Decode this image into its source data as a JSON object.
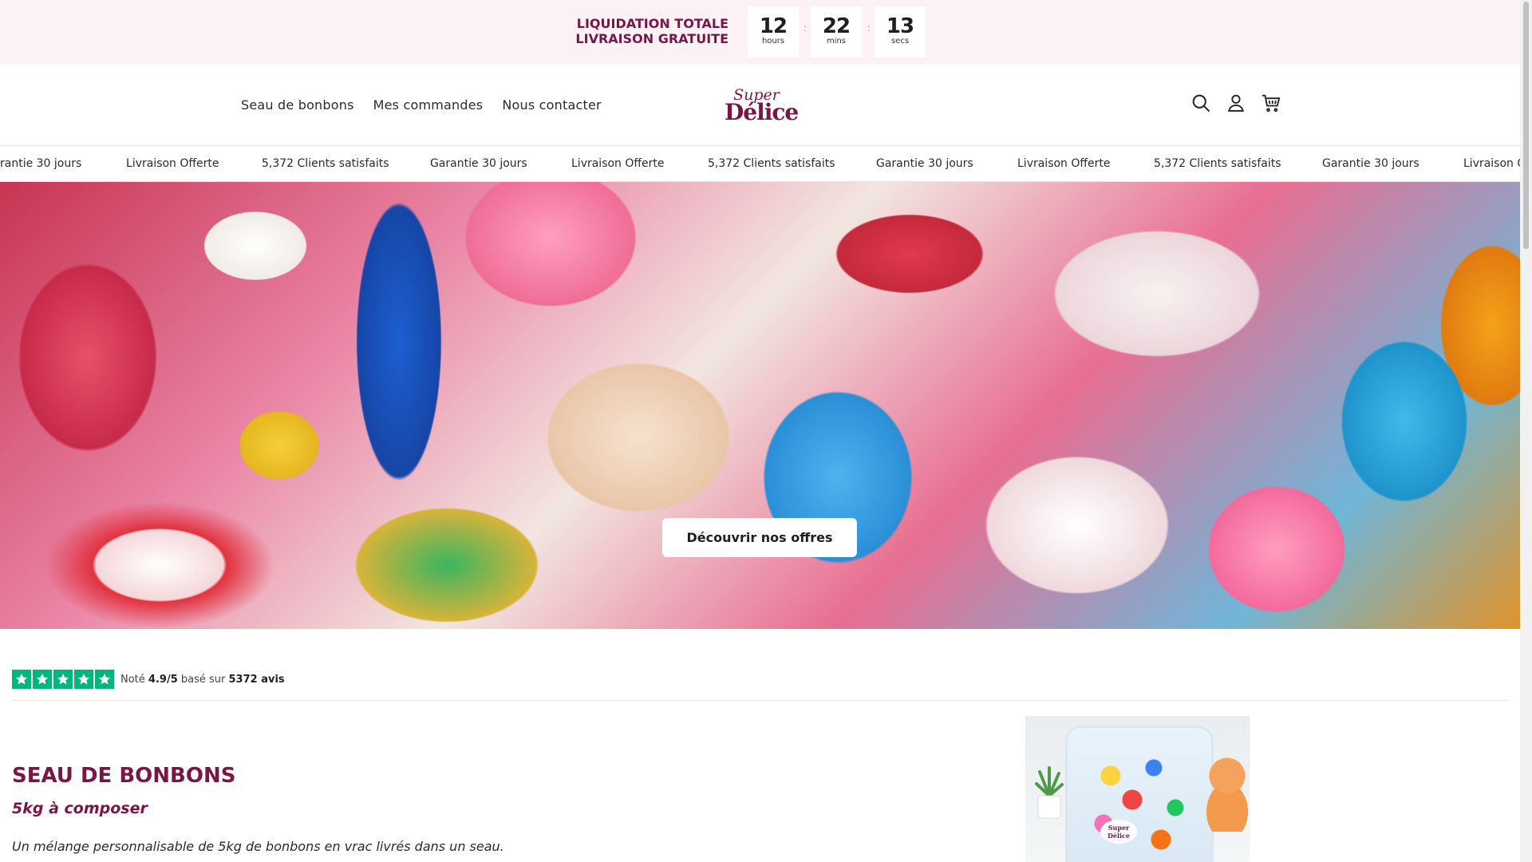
{
  "announcement": {
    "line1": "LIQUIDATION TOTALE",
    "line2": "LIVRAISON GRATUITE",
    "countdown": [
      {
        "value": "12",
        "unit": "hours"
      },
      {
        "value": "22",
        "unit": "mins"
      },
      {
        "value": "13",
        "unit": "secs"
      }
    ]
  },
  "header": {
    "nav": [
      "Seau de bonbons",
      "Mes commandes",
      "Nous contacter"
    ],
    "logo": {
      "super": "Super",
      "delice": "Délice"
    },
    "icons": [
      "search-icon",
      "account-icon",
      "cart-icon"
    ]
  },
  "marquee": {
    "items": [
      "rantie 30 jours",
      "Livraison Offerte",
      "5,372 Clients satisfaits",
      "Garantie 30 jours",
      "Livraison Offerte",
      "5,372 Clients satisfaits",
      "Garantie 30 jours",
      "Livraison Offerte",
      "5,372 Clients satisfaits",
      "Garantie 30 jours",
      "Livraison O"
    ]
  },
  "hero": {
    "cta": "Découvrir nos offres"
  },
  "rating": {
    "prefix": "Noté",
    "score": "4.9/5",
    "middle": "basé sur",
    "count": "5372 avis",
    "stars": 5,
    "star_color": "#00b67a"
  },
  "product": {
    "title": "SEAU DE BONBONS",
    "subtitle": "5kg à composer",
    "description": "Un mélange personnalisable de 5kg de bonbons en vrac livrés dans un seau.",
    "image_label": {
      "super": "Super",
      "delice": "Délice"
    }
  },
  "colors": {
    "brand": "#7a1646",
    "announcement_bg": "#fcf1f4",
    "trust_green": "#00b67a"
  }
}
